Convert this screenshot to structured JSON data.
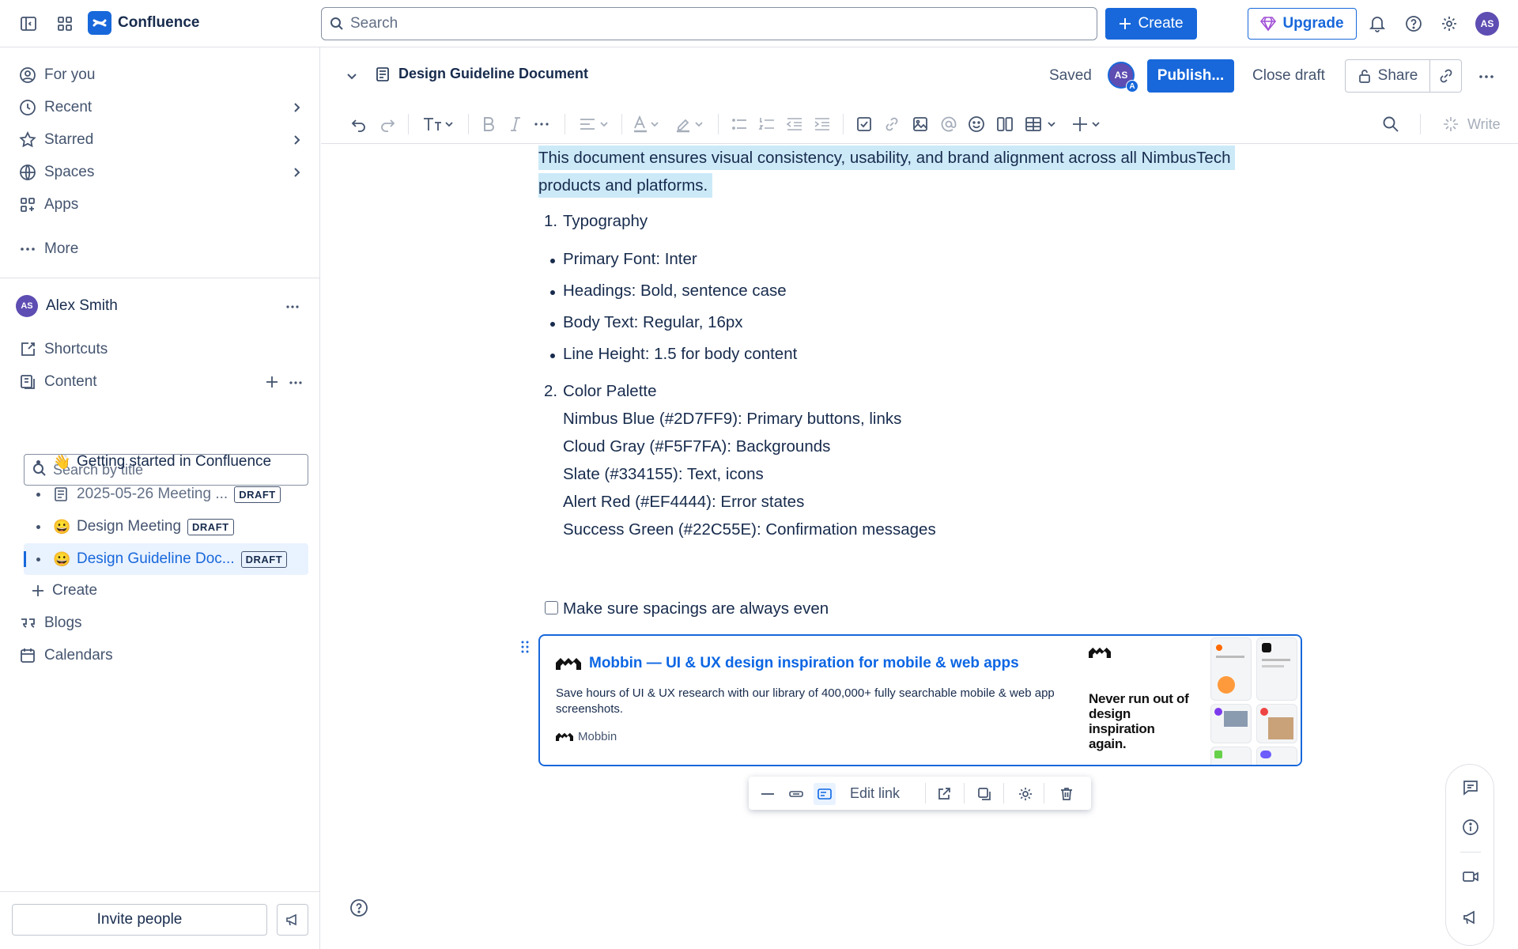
{
  "app": {
    "name": "Confluence"
  },
  "topbar": {
    "search_placeholder": "Search",
    "create_label": "Create",
    "upgrade_label": "Upgrade",
    "avatar_initials": "AS"
  },
  "sidebar": {
    "nav": [
      {
        "label": "For you"
      },
      {
        "label": "Recent"
      },
      {
        "label": "Starred"
      },
      {
        "label": "Spaces"
      },
      {
        "label": "Apps"
      },
      {
        "label": "More"
      }
    ],
    "user": {
      "name": "Alex Smith",
      "initials": "AS"
    },
    "shortcuts_label": "Shortcuts",
    "content_label": "Content",
    "search_placeholder": "Search by title",
    "tree": [
      {
        "emoji": "👋",
        "title": "Getting started in Confluence",
        "draft": ""
      },
      {
        "emoji": "",
        "title": "2025-05-26 Meeting ...",
        "draft": "DRAFT"
      },
      {
        "emoji": "😀",
        "title": "Design Meeting",
        "draft": "DRAFT"
      },
      {
        "emoji": "😀",
        "title": "Design Guideline Doc...",
        "draft": "DRAFT"
      }
    ],
    "create_label": "Create",
    "blogs_label": "Blogs",
    "calendars_label": "Calendars",
    "invite_label": "Invite people"
  },
  "doc": {
    "title": "Design Guideline Document",
    "saved": "Saved",
    "avatar_initials": "AS",
    "avatar_badge": "A",
    "publish_label": "Publish...",
    "close_draft_label": "Close draft",
    "share_label": "Share",
    "write_label": "Write",
    "highlight_line1": "This document ensures visual consistency, usability, and brand alignment across all NimbusTech",
    "highlight_line2": "products and platforms.",
    "sections": [
      {
        "num": "1.",
        "heading": "Typography"
      },
      {
        "num": "2.",
        "heading": "Color Palette"
      }
    ],
    "typography_items": [
      "Primary Font: Inter",
      "Headings: Bold, sentence case",
      "Body Text: Regular, 16px",
      "Line Height: 1.5 for body content"
    ],
    "palette_lines": [
      "Nimbus Blue (#2D7FF9): Primary buttons, links",
      "Cloud Gray (#F5F7FA): Backgrounds",
      "Slate (#334155): Text, icons",
      "Alert Red (#EF4444): Error states",
      "Success Green (#22C55E): Confirmation messages"
    ],
    "task": {
      "label": "Make sure spacings are always even",
      "checked": false
    },
    "link_card": {
      "title": "Mobbin — UI & UX design inspiration for mobile & web apps",
      "description": "Save hours of UI & UX research with our library of 400,000+ fully searchable mobile & web app screenshots.",
      "source": "Mobbin",
      "image_slogan": "Never run out of design inspiration again."
    },
    "floating_toolbar": {
      "edit_link_label": "Edit link"
    }
  },
  "colors": {
    "brand": "#1868db",
    "highlight": "#cce9f8",
    "link": "#0c66e4",
    "avatar": "#5e4db2"
  }
}
